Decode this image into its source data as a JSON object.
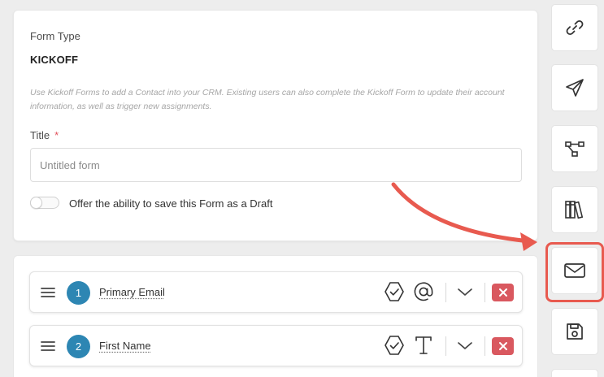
{
  "form": {
    "form_type_label": "Form Type",
    "form_type_value": "KICKOFF",
    "description": "Use Kickoff Forms to add a Contact into your CRM. Existing users can also complete the Kickoff Form to update their account information, as well as trigger new assignments.",
    "title_label": "Title",
    "required_marker": "*",
    "title_placeholder": "Untitled form",
    "title_value": "",
    "draft_toggle_label": "Offer the ability to save this Form as a Draft",
    "draft_toggle_on": false
  },
  "fields": [
    {
      "number": "1",
      "name": "Primary Email",
      "type_icon": "at-sign-icon"
    },
    {
      "number": "2",
      "name": "First Name",
      "type_icon": "text-type-icon"
    }
  ],
  "sidebar": {
    "items": [
      {
        "icon": "link-icon"
      },
      {
        "icon": "send-icon"
      },
      {
        "icon": "workflow-icon"
      },
      {
        "icon": "library-icon"
      },
      {
        "icon": "envelope-icon",
        "highlighted": true
      },
      {
        "icon": "save-icon"
      }
    ]
  },
  "colors": {
    "badge": "#2d86b3",
    "delete": "#d9585f",
    "highlight": "#e85a4f",
    "required": "#e2525c"
  }
}
